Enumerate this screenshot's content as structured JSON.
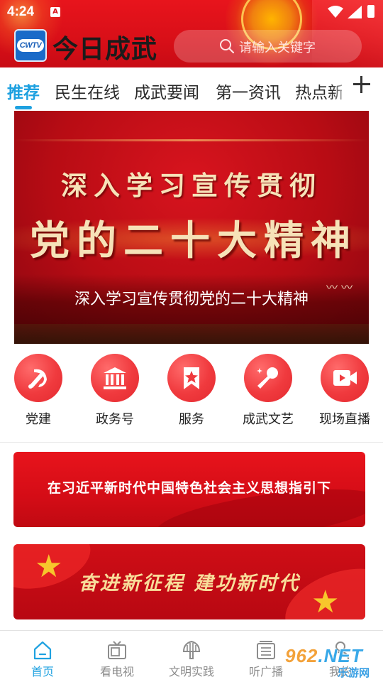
{
  "status_bar": {
    "time": "4:24",
    "notification_glyph": "A"
  },
  "header": {
    "logo_text": "CWTV",
    "app_title": "今日成武",
    "search_placeholder": "请输入关键字",
    "colors": {
      "header_red": "#d80f18",
      "accent_blue": "#1ea1e0"
    }
  },
  "tabs": {
    "items": [
      {
        "label": "推荐",
        "active": true
      },
      {
        "label": "民生在线",
        "active": false
      },
      {
        "label": "成武要闻",
        "active": false
      },
      {
        "label": "第一资讯",
        "active": false
      },
      {
        "label": "热点新",
        "active": false
      }
    ],
    "more_icon": "plus-icon"
  },
  "hero": {
    "line1": "深入学习宣传贯彻",
    "line2": "党的二十大精神",
    "caption": "深入学习宣传贯彻党的二十大精神"
  },
  "shortcuts": [
    {
      "label": "党建",
      "icon": "party-emblem-icon"
    },
    {
      "label": "政务号",
      "icon": "government-building-icon"
    },
    {
      "label": "服务",
      "icon": "bookmark-star-icon"
    },
    {
      "label": "成武文艺",
      "icon": "microphone-icon"
    },
    {
      "label": "现场直播",
      "icon": "video-camera-icon"
    }
  ],
  "banners": [
    {
      "text": "在习近平新时代中国特色社会主义思想指引下"
    },
    {
      "text": "奋进新征程 建功新时代"
    }
  ],
  "bottom_nav": [
    {
      "label": "首页",
      "icon": "home-icon",
      "active": true
    },
    {
      "label": "看电视",
      "icon": "tv-icon",
      "active": false
    },
    {
      "label": "文明实践",
      "icon": "temple-icon",
      "active": false
    },
    {
      "label": "听广播",
      "icon": "radio-icon",
      "active": false
    },
    {
      "label": "我的",
      "icon": "user-icon",
      "active": false
    }
  ],
  "watermark": {
    "top": "962",
    "net": ".NET",
    "bottom": "乐游网"
  }
}
